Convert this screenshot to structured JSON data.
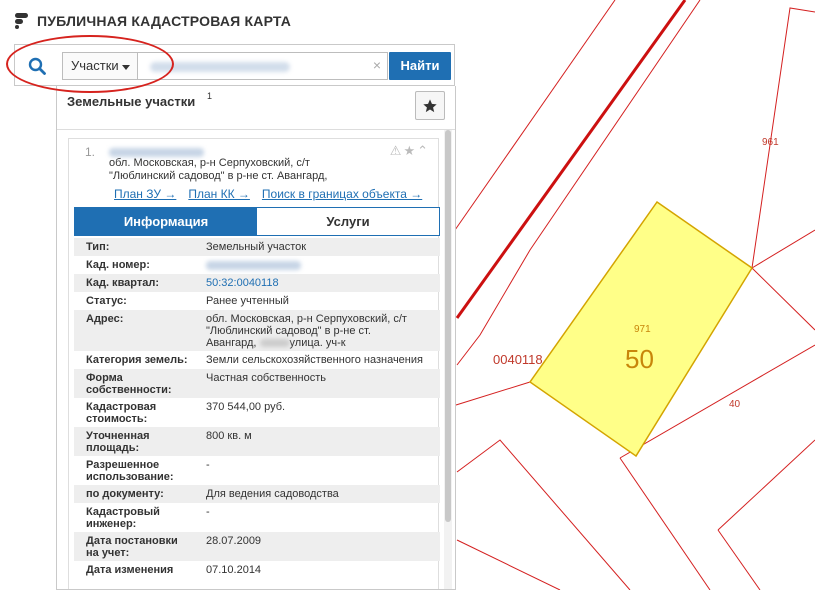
{
  "app": {
    "title": "ПУБЛИЧНАЯ КАДАСТРОВАЯ КАРТА"
  },
  "search": {
    "type_label": "Участки",
    "button_label": "Найти",
    "clear_symbol": "×"
  },
  "panel": {
    "title": "Земельные участки",
    "count": "1",
    "result": {
      "number": "1.",
      "address_line1": "обл. Московская, р-н Серпуховский, с/т",
      "address_line2": "\"Люблинский садовод\" в р-не ст. Авангард,",
      "links": [
        "План ЗУ →",
        "План КК →",
        "Поиск в границах объекта →"
      ],
      "tabs": [
        "Информация",
        "Услуги"
      ],
      "properties": [
        {
          "key": "Тип:",
          "value": "Земельный участок"
        },
        {
          "key": "Кад. номер:",
          "value": ""
        },
        {
          "key": "Кад. квартал:",
          "value": "50:32:0040118"
        },
        {
          "key": "Статус:",
          "value": "Ранее учтенный"
        },
        {
          "key": "Адрес:",
          "value_line1": "обл. Московская, р-н Серпуховский, с/т",
          "value_line2": "\"Люблинский садовод\" в р-не ст.",
          "value_line3a": "Авангард, ",
          "value_line3b": "улица. уч-к"
        },
        {
          "key": "Категория земель:",
          "value": "Земли сельскохозяйственного назначения"
        },
        {
          "key_line1": "Форма",
          "key_line2": "собственности:",
          "value": "Частная собственность"
        },
        {
          "key_line1": "Кадастровая",
          "key_line2": "стоимость:",
          "value": "370 544,00 руб."
        },
        {
          "key_line1": "Уточненная",
          "key_line2": "площадь:",
          "value": "800 кв. м"
        },
        {
          "key_line1": "Разрешенное",
          "key_line2": "использование:",
          "value": "-"
        },
        {
          "key": "по документу:",
          "value": "Для ведения садоводства"
        },
        {
          "key_line1": "Кадастровый",
          "key_line2": "инженер:",
          "value": "-"
        },
        {
          "key_line1": "Дата постановки",
          "key_line2": "на учет:",
          "value": "28.07.2009"
        },
        {
          "key_line1": "Дата изменения",
          "value": "07.10.2014"
        }
      ]
    }
  },
  "map": {
    "labels": {
      "parcel_number": "50",
      "parcel_sublabel": "971",
      "label_961": "961",
      "label_40": "40",
      "quarter_label": "0040118"
    },
    "colors": {
      "parcel_fill": "#ffff88",
      "parcel_stroke": "#d4a400",
      "lines": "#d42020",
      "parcel_text": "#c8860a"
    }
  },
  "colors": {
    "accent": "#1f6fb3",
    "highlight_oval": "#d6231e"
  }
}
